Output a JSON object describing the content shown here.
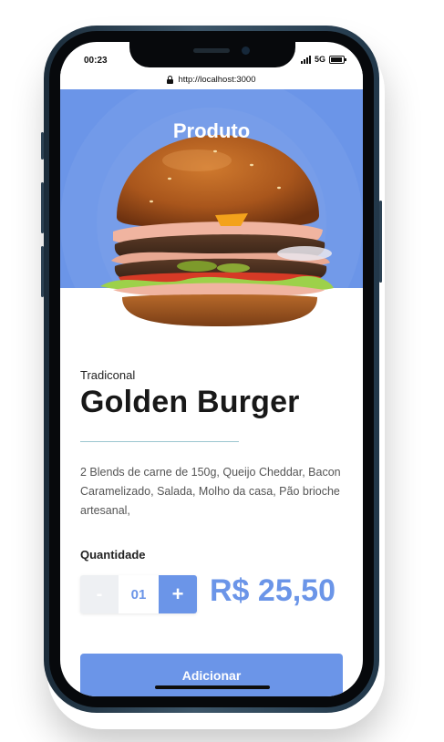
{
  "status_bar": {
    "time": "00:23",
    "network": "5G"
  },
  "browser": {
    "url": "http://localhost:3000"
  },
  "header": {
    "title": "Produto"
  },
  "product": {
    "category": "Tradiconal",
    "name": "Golden Burger",
    "description": "2 Blends de carne de 150g, Queijo Cheddar, Bacon Caramelizado, Salada, Molho da casa, Pão brioche artesanal,",
    "quantity_label": "Quantidade",
    "quantity": "01",
    "minus_label": "-",
    "plus_label": "+",
    "price": "R$ 25,50",
    "add_button_label": "Adicionar"
  },
  "colors": {
    "accent": "#6b95e8",
    "divider": "#9bc6cf"
  },
  "icons": [
    "arrow-left-icon",
    "lock-icon",
    "signal-icon",
    "battery-icon"
  ]
}
